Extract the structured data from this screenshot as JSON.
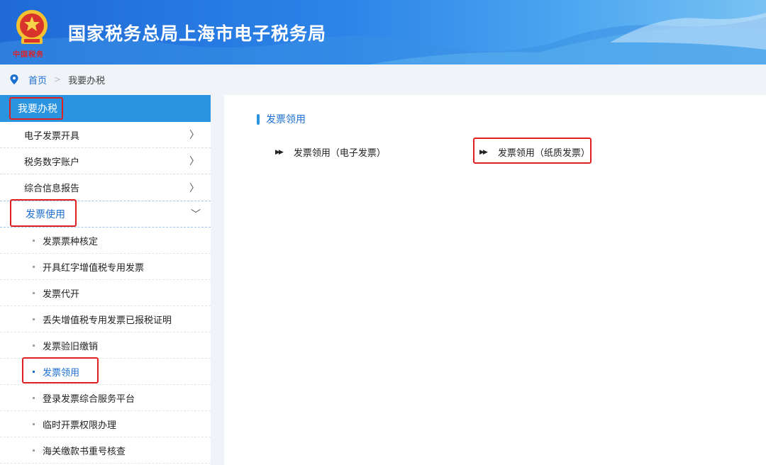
{
  "header": {
    "site_title": "国家税务总局上海市电子税务局",
    "brand_script": "中国税务",
    "emblem_icon": "tax-emblem-icon",
    "gradient_colors": [
      "#1f6ad6",
      "#4ea7f0",
      "#79c2f3"
    ]
  },
  "breadcrumb": {
    "home": "首页",
    "separator": ">",
    "current": "我要办税"
  },
  "sidebar": {
    "header": "我要办税",
    "items": [
      {
        "label": "电子发票开具",
        "arrow": "〉"
      },
      {
        "label": "税务数字账户",
        "arrow": "〉"
      },
      {
        "label": "综合信息报告",
        "arrow": "〉"
      }
    ],
    "group": {
      "label": "发票使用",
      "arrow": "﹀"
    },
    "sub_items": [
      {
        "label": "发票票种核定"
      },
      {
        "label": "开具红字增值税专用发票"
      },
      {
        "label": "发票代开"
      },
      {
        "label": "丢失增值税专用发票已报税证明"
      },
      {
        "label": "发票验旧缴销"
      },
      {
        "label": "发票领用"
      },
      {
        "label": "登录发票综合服务平台"
      },
      {
        "label": "临时开票权限办理"
      },
      {
        "label": "海关缴款书重号核查"
      }
    ],
    "active_sub_item": "发票领用"
  },
  "main": {
    "section_title": "发票领用",
    "links": [
      {
        "label": "发票领用（电子发票）",
        "icon": "double-triangle-icon"
      },
      {
        "label": "发票领用（纸质发票）",
        "icon": "double-triangle-icon"
      }
    ]
  },
  "colors": {
    "accent": "#2a94e0",
    "link_blue": "#1c6fd1",
    "highlight_red": "#e02020"
  }
}
